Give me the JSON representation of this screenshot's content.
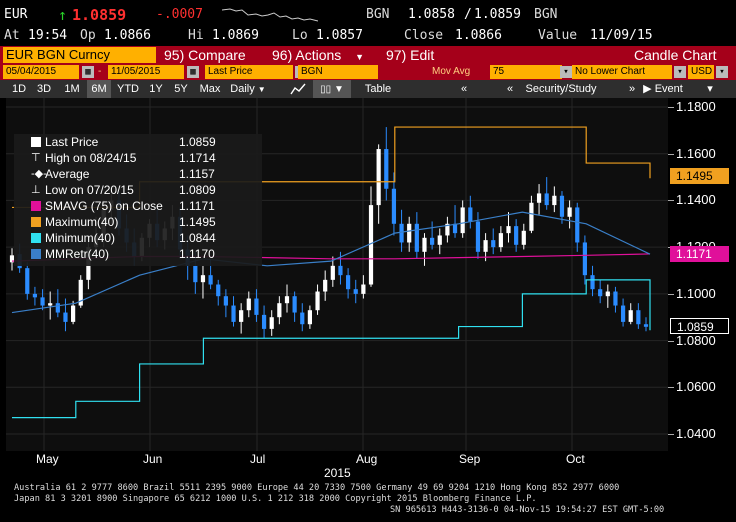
{
  "quote": {
    "ticker": "EUR",
    "arrow": "↑",
    "last": "1.0859",
    "change": "-.0007",
    "currency": "BGN",
    "bid": "1.0858",
    "ask": "1.0859",
    "currency2": "BGN",
    "at_label": "At",
    "at_time": "19:54",
    "op_label": "Op",
    "op_val": "1.0866",
    "hi_label": "Hi",
    "hi_val": "1.0869",
    "lo_label": "Lo",
    "lo_val": "1.0857",
    "close_label": "Close",
    "close_val": "1.0866",
    "value_label": "Value",
    "value_date": "11/09/15"
  },
  "menu": {
    "security": "EUR BGN Curncy",
    "compare": "95) Compare",
    "actions": "96) Actions",
    "edit": "97) Edit",
    "chart_type": "Candle Chart"
  },
  "params": {
    "start_date": "05/04/2015",
    "end_date": "11/05/2015",
    "field": "Last Price",
    "ccy_code": "BGN",
    "mov_avg_label": "Mov Avg",
    "mov_avg_val": "75",
    "lower_chart": "No Lower Chart",
    "currency": "USD"
  },
  "toolbar": {
    "periods": [
      "1D",
      "3D",
      "1M",
      "6M",
      "YTD",
      "1Y",
      "5Y",
      "Max"
    ],
    "selected_period": "6M",
    "frequency": "Daily",
    "table": "Table",
    "security_study": "Security/Study",
    "event": "Event"
  },
  "legend": [
    {
      "name": "Last Price",
      "value": "1.0859",
      "color": "#ffffff",
      "icon": "square"
    },
    {
      "name": "High on 08/24/15",
      "value": "1.1714",
      "color": "#ffffff",
      "icon": "high-marker"
    },
    {
      "name": "Average",
      "value": "1.1157",
      "color": "#ffffff",
      "icon": "average-marker"
    },
    {
      "name": "Low on 07/20/15",
      "value": "1.0809",
      "color": "#ffffff",
      "icon": "low-marker"
    },
    {
      "name": "SMAVG (75) on Close",
      "value": "1.1171",
      "color": "#e0109a",
      "icon": "square"
    },
    {
      "name": "Maximum(40)",
      "value": "1.1495",
      "color": "#f0a020",
      "icon": "square"
    },
    {
      "name": "Minimum(40)",
      "value": "1.0844",
      "color": "#30e0f0",
      "icon": "square"
    },
    {
      "name": "MMRetr(40)",
      "value": "1.1170",
      "color": "#3a7fc8",
      "icon": "square"
    }
  ],
  "value_tags": {
    "maximum": "1.1495",
    "smavg": "1.1171",
    "last": "1.0859"
  },
  "colors": {
    "candle_up": "#ffffff",
    "candle_down": "#2b8cff",
    "smavg": "#e0109a",
    "maximum": "#f0a020",
    "minimum": "#30e0f0",
    "mmretr": "#3a7fc8",
    "accent": "#a5001a",
    "field_bg": "#ffb000"
  },
  "chart_data": {
    "type": "candlestick",
    "title": "",
    "xlabel": "2015",
    "ylabel": "",
    "ylim": [
      1.03,
      1.185
    ],
    "y_ticks": [
      "1.1800",
      "1.1600",
      "1.1400",
      "1.1200",
      "1.1000",
      "1.0800",
      "1.0600",
      "1.0400"
    ],
    "x_ticks": [
      "May",
      "Jun",
      "Jul",
      "Aug",
      "Sep",
      "Oct"
    ],
    "x_axis_year": "2015",
    "candles": [
      [
        1.1135,
        1.1195,
        1.11,
        1.1165
      ],
      [
        1.117,
        1.1215,
        1.109,
        1.111
      ],
      [
        1.111,
        1.1135,
        1.0975,
        1.1
      ],
      [
        1.1,
        1.103,
        1.095,
        1.0985
      ],
      [
        1.0985,
        1.102,
        1.093,
        1.095
      ],
      [
        1.095,
        1.101,
        1.089,
        1.096
      ],
      [
        1.096,
        1.102,
        1.09,
        1.092
      ],
      [
        1.092,
        1.098,
        1.084,
        1.088
      ],
      [
        1.088,
        1.097,
        1.087,
        1.095
      ],
      [
        1.095,
        1.108,
        1.094,
        1.106
      ],
      [
        1.106,
        1.125,
        1.102,
        1.12
      ],
      [
        1.12,
        1.133,
        1.116,
        1.125
      ],
      [
        1.125,
        1.14,
        1.12,
        1.136
      ],
      [
        1.136,
        1.144,
        1.13,
        1.14
      ],
      [
        1.14,
        1.144,
        1.125,
        1.128
      ],
      [
        1.128,
        1.134,
        1.118,
        1.122
      ],
      [
        1.122,
        1.128,
        1.112,
        1.116
      ],
      [
        1.116,
        1.126,
        1.114,
        1.124
      ],
      [
        1.124,
        1.132,
        1.12,
        1.13
      ],
      [
        1.13,
        1.136,
        1.12,
        1.123
      ],
      [
        1.123,
        1.131,
        1.119,
        1.128
      ],
      [
        1.128,
        1.138,
        1.123,
        1.133
      ],
      [
        1.133,
        1.137,
        1.115,
        1.119
      ],
      [
        1.119,
        1.125,
        1.106,
        1.112
      ],
      [
        1.112,
        1.118,
        1.1,
        1.105
      ],
      [
        1.105,
        1.112,
        1.098,
        1.108
      ],
      [
        1.108,
        1.115,
        1.102,
        1.104
      ],
      [
        1.104,
        1.106,
        1.095,
        1.099
      ],
      [
        1.099,
        1.102,
        1.09,
        1.095
      ],
      [
        1.095,
        1.099,
        1.086,
        1.088
      ],
      [
        1.088,
        1.096,
        1.083,
        1.093
      ],
      [
        1.093,
        1.101,
        1.09,
        1.098
      ],
      [
        1.098,
        1.102,
        1.088,
        1.091
      ],
      [
        1.091,
        1.095,
        1.081,
        1.085
      ],
      [
        1.085,
        1.093,
        1.082,
        1.09
      ],
      [
        1.09,
        1.099,
        1.087,
        1.096
      ],
      [
        1.096,
        1.104,
        1.092,
        1.099
      ],
      [
        1.099,
        1.101,
        1.088,
        1.092
      ],
      [
        1.092,
        1.096,
        1.084,
        1.087
      ],
      [
        1.087,
        1.095,
        1.085,
        1.093
      ],
      [
        1.093,
        1.104,
        1.091,
        1.101
      ],
      [
        1.101,
        1.11,
        1.097,
        1.106
      ],
      [
        1.106,
        1.116,
        1.103,
        1.112
      ],
      [
        1.112,
        1.118,
        1.104,
        1.108
      ],
      [
        1.108,
        1.111,
        1.098,
        1.102
      ],
      [
        1.102,
        1.106,
        1.096,
        1.1
      ],
      [
        1.1,
        1.108,
        1.098,
        1.104
      ],
      [
        1.104,
        1.146,
        1.103,
        1.138
      ],
      [
        1.138,
        1.164,
        1.13,
        1.162
      ],
      [
        1.162,
        1.1714,
        1.14,
        1.145
      ],
      [
        1.145,
        1.152,
        1.125,
        1.13
      ],
      [
        1.13,
        1.136,
        1.118,
        1.122
      ],
      [
        1.122,
        1.133,
        1.118,
        1.13
      ],
      [
        1.13,
        1.135,
        1.115,
        1.118
      ],
      [
        1.118,
        1.126,
        1.112,
        1.124
      ],
      [
        1.124,
        1.131,
        1.119,
        1.121
      ],
      [
        1.121,
        1.128,
        1.117,
        1.125
      ],
      [
        1.125,
        1.133,
        1.122,
        1.13
      ],
      [
        1.13,
        1.138,
        1.124,
        1.126
      ],
      [
        1.126,
        1.14,
        1.124,
        1.137
      ],
      [
        1.137,
        1.142,
        1.128,
        1.131
      ],
      [
        1.131,
        1.135,
        1.115,
        1.118
      ],
      [
        1.118,
        1.126,
        1.114,
        1.123
      ],
      [
        1.123,
        1.128,
        1.117,
        1.12
      ],
      [
        1.12,
        1.129,
        1.118,
        1.126
      ],
      [
        1.126,
        1.135,
        1.122,
        1.129
      ],
      [
        1.129,
        1.132,
        1.118,
        1.121
      ],
      [
        1.121,
        1.13,
        1.119,
        1.127
      ],
      [
        1.127,
        1.142,
        1.126,
        1.139
      ],
      [
        1.139,
        1.147,
        1.134,
        1.143
      ],
      [
        1.143,
        1.15,
        1.136,
        1.138
      ],
      [
        1.138,
        1.146,
        1.135,
        1.142
      ],
      [
        1.142,
        1.144,
        1.13,
        1.133
      ],
      [
        1.133,
        1.14,
        1.128,
        1.137
      ],
      [
        1.137,
        1.139,
        1.118,
        1.122
      ],
      [
        1.122,
        1.125,
        1.104,
        1.108
      ],
      [
        1.108,
        1.112,
        1.099,
        1.102
      ],
      [
        1.102,
        1.106,
        1.096,
        1.099
      ],
      [
        1.099,
        1.104,
        1.094,
        1.101
      ],
      [
        1.101,
        1.103,
        1.092,
        1.095
      ],
      [
        1.095,
        1.098,
        1.086,
        1.088
      ],
      [
        1.088,
        1.096,
        1.087,
        1.093
      ],
      [
        1.093,
        1.096,
        1.085,
        1.087
      ],
      [
        1.087,
        1.09,
        1.084,
        1.0859
      ]
    ],
    "series": [
      {
        "name": "SMAVG (75) on Close",
        "color": "#e0109a",
        "values": [
          1.114,
          1.115,
          1.116,
          1.116,
          1.1155,
          1.115,
          1.115,
          1.1155,
          1.116,
          1.1165,
          1.1171
        ]
      },
      {
        "name": "Maximum(40)",
        "color": "#f0a020",
        "values": [
          1.137,
          1.137,
          1.148,
          1.148,
          1.148,
          1.148,
          1.1714,
          1.1714,
          1.1714,
          1.156,
          1.1495
        ]
      },
      {
        "name": "Minimum(40)",
        "color": "#30e0f0",
        "values": [
          1.047,
          1.054,
          1.07,
          1.081,
          1.081,
          1.081,
          1.081,
          1.086,
          1.1,
          1.106,
          1.0844
        ]
      },
      {
        "name": "MMRetr(40)",
        "color": "#3a7fc8",
        "values": [
          1.092,
          1.096,
          1.108,
          1.115,
          1.112,
          1.114,
          1.126,
          1.13,
          1.135,
          1.13,
          1.117
        ]
      }
    ],
    "grid": true,
    "legend_placement": "top-left"
  },
  "footer": {
    "line1": "Australia 61 2 9777 8600 Brazil 5511 2395 9000 Europe 44 20 7330 7500 Germany 49 69 9204 1210 Hong Kong 852 2977 6000",
    "line2": "Japan 81 3 3201 8900        Singapore 65 6212 1000        U.S. 1 212 318 2000        Copyright 2015 Bloomberg Finance L.P.",
    "line3": "SN 965613 H443-3136-0 04-Nov-15 19:54:27 EST  GMT-5:00"
  }
}
